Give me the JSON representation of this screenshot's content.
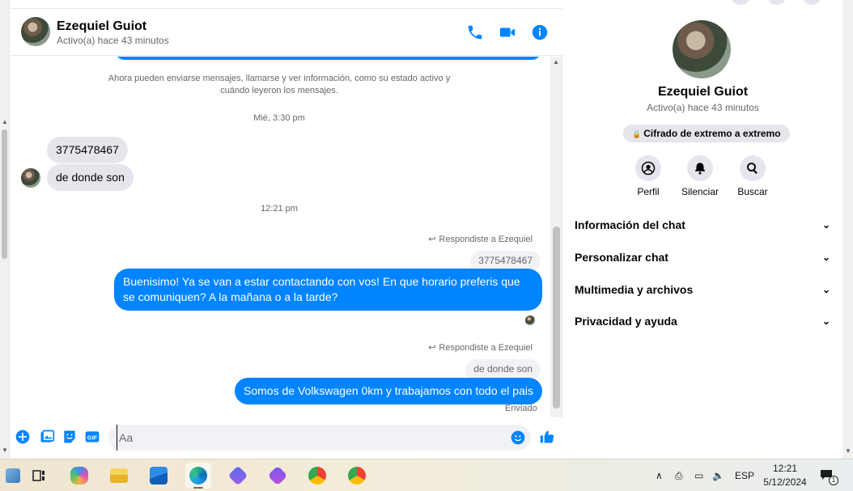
{
  "header": {
    "name": "Ezequiel Guiot",
    "status": "Activo(a) hace 43 minutos",
    "icons": [
      "phone-icon",
      "video-camera-icon",
      "info-icon"
    ]
  },
  "messages": {
    "system_note": "Ahora pueden enviarse mensajes, llamarse y ver información, como su estado activo y cuándo leyeron los mensajes.",
    "time_1": "Mié, 3:30 pm",
    "in_1": "3775478467",
    "in_2": "de donde son",
    "time_2": "12:21 pm",
    "reply_note_1": "Respondiste a Ezequiel",
    "quoted_1": "3775478467",
    "out_1": "Buenisimo! Ya se van a estar contactando con vos! En que horario preferis que se comuniquen? A la mañana o a la tarde?",
    "reply_note_2": "Respondiste a Ezequiel",
    "quoted_2": "de donde son",
    "out_2": "Somos de Volkswagen 0km y trabajamos con todo el pais",
    "sent_label": "Enviado"
  },
  "composer": {
    "placeholder": "Aa",
    "icons": [
      "plus-icon",
      "image-icon",
      "sticker-icon",
      "gif-icon",
      "emoji-icon",
      "like-icon"
    ]
  },
  "info": {
    "name": "Ezequiel Guiot",
    "status": "Activo(a) hace 43 minutos",
    "encryption_badge": "Cifrado de extremo a extremo",
    "actions": [
      {
        "label": "Perfil",
        "icon": "profile-icon"
      },
      {
        "label": "Silenciar",
        "icon": "bell-icon"
      },
      {
        "label": "Buscar",
        "icon": "search-icon"
      }
    ],
    "sections": [
      {
        "label": "Información del chat"
      },
      {
        "label": "Personalizar chat"
      },
      {
        "label": "Multimedia y archivos"
      },
      {
        "label": "Privacidad y ayuda"
      }
    ]
  },
  "taskbar": {
    "apps": [
      "task-view-icon",
      "copilot-icon",
      "file-explorer-icon",
      "mail-icon",
      "edge-icon",
      "teams-icon",
      "copilot-app-icon",
      "chrome-profile-icon",
      "chrome-icon"
    ],
    "language": "ESP",
    "time": "12:21",
    "date": "5/12/2024",
    "notification_count": "1"
  },
  "colors": {
    "accent": "#0084ff",
    "incoming_bubble": "#e4e6eb",
    "secondary_text": "#65676b"
  }
}
